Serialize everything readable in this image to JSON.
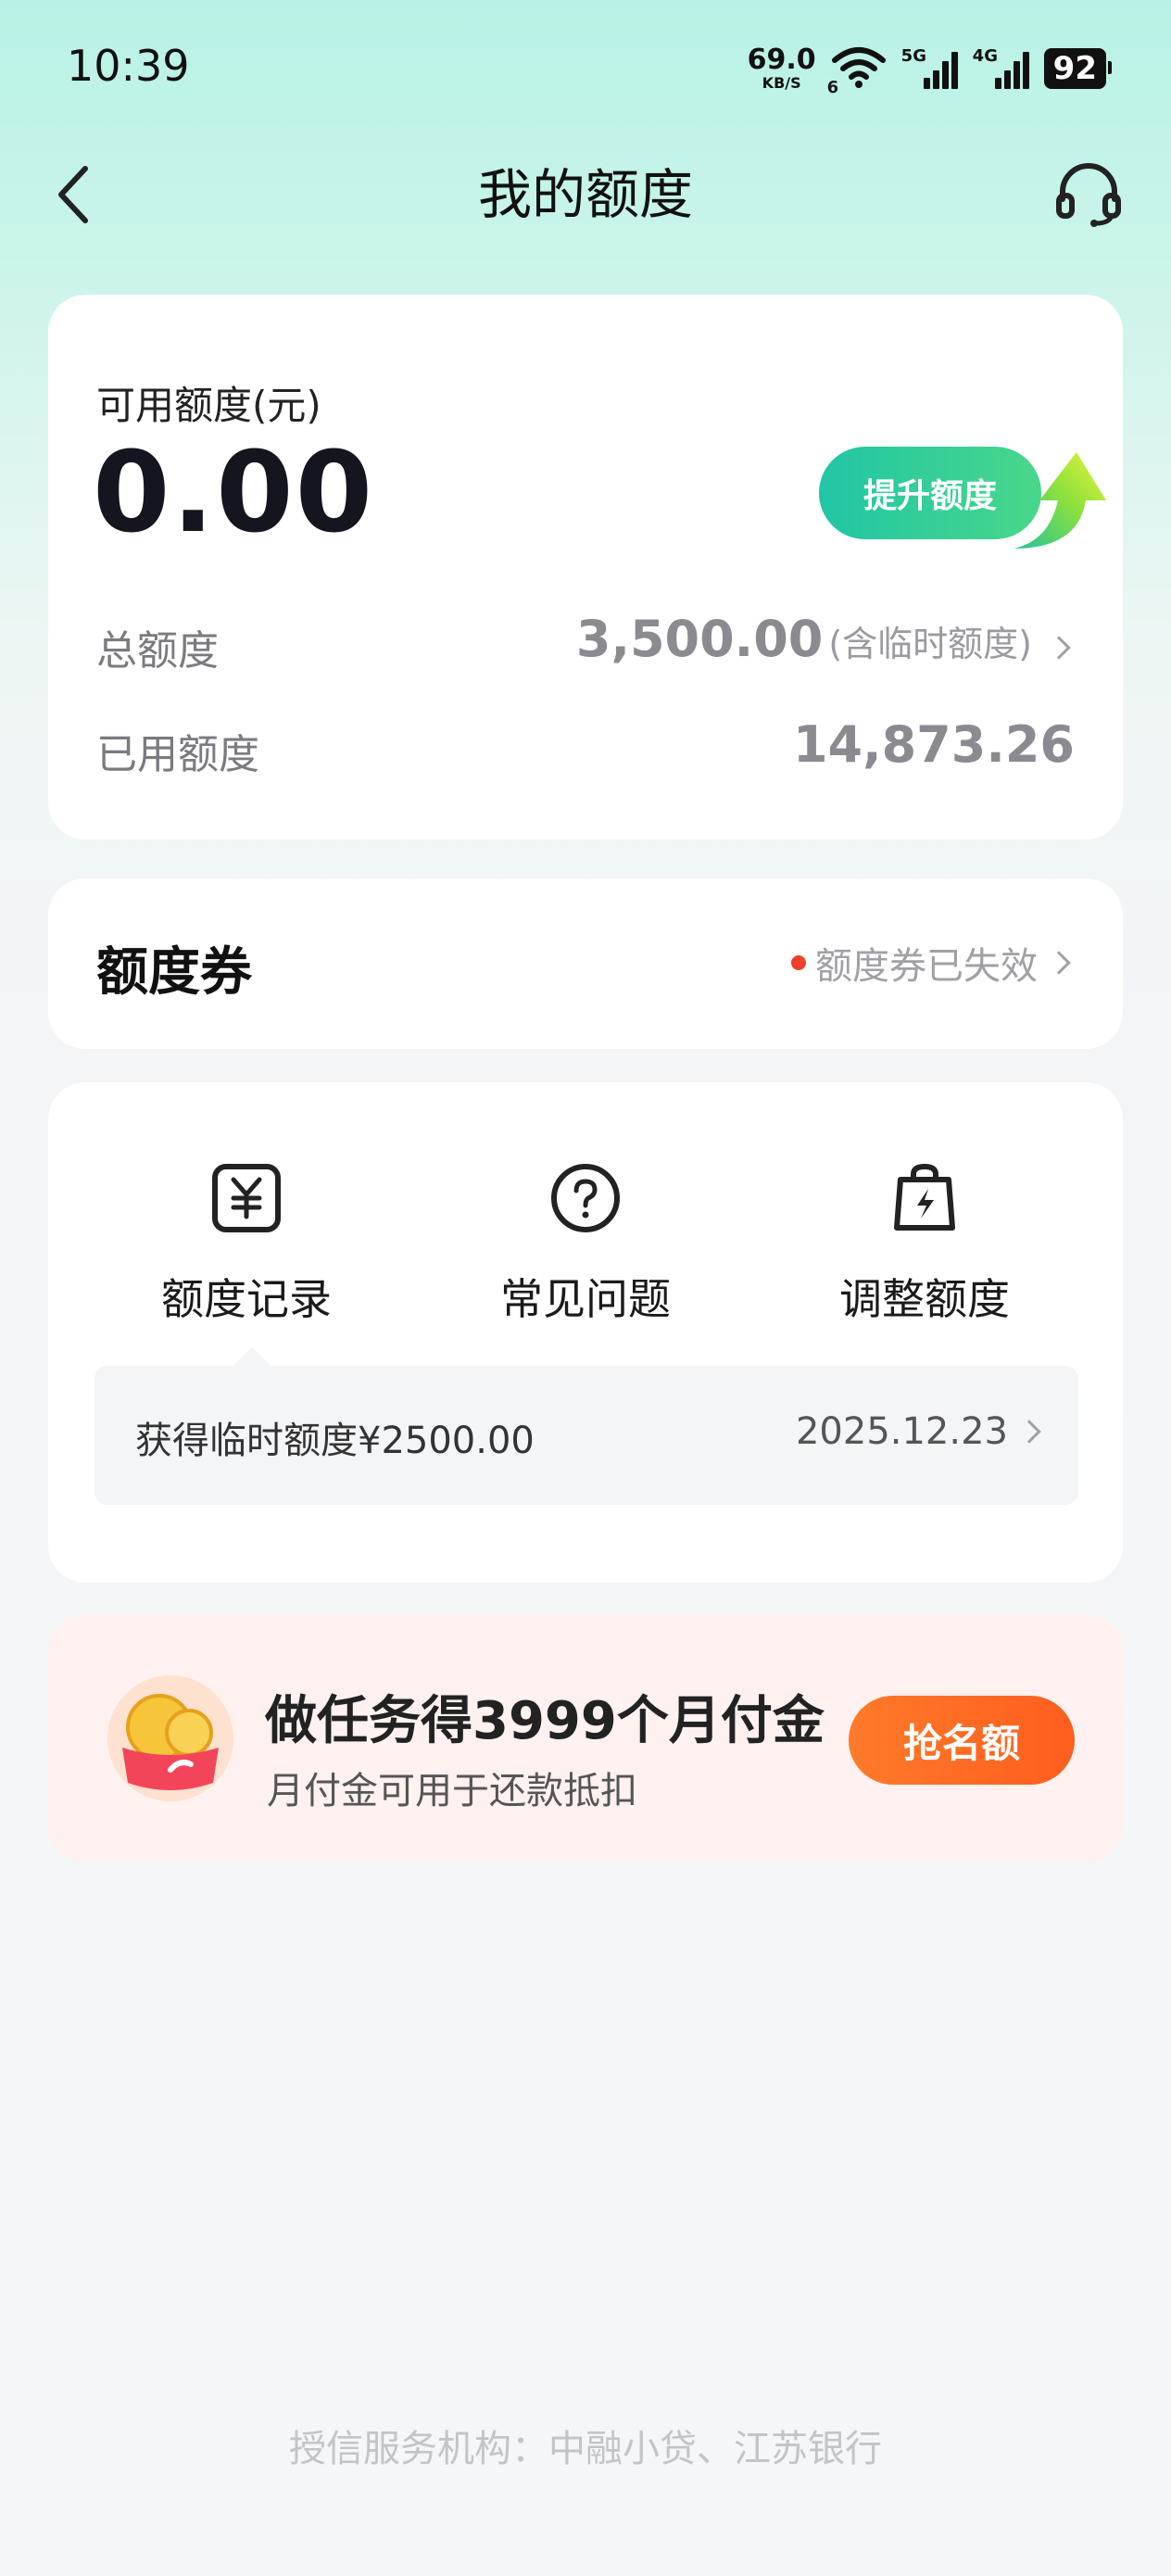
{
  "status_bar": {
    "time": "10:39",
    "net_speed": "69.0",
    "net_unit": "KB/S",
    "wifi_sub": "6",
    "signal1_label": "5G",
    "signal2_label": "4G",
    "battery": "92"
  },
  "nav": {
    "title": "我的额度",
    "back_icon": "chevron-left-icon",
    "service_icon": "headset-icon"
  },
  "credit": {
    "available_label": "可用额度(元)",
    "available_value": "0.00",
    "raise_button": "提升额度",
    "total_label": "总额度",
    "total_value": "3,500.00",
    "total_note": "(含临时额度)",
    "used_label": "已用额度",
    "used_value": "14,873.26"
  },
  "coupon": {
    "title": "额度券",
    "status": "额度券已失效"
  },
  "actions": {
    "items": [
      {
        "label": "额度记录",
        "icon": "yuan-receipt-icon"
      },
      {
        "label": "常见问题",
        "icon": "question-circle-icon"
      },
      {
        "label": "调整额度",
        "icon": "lightning-bag-icon"
      }
    ],
    "record_text": "获得临时额度¥2500.00",
    "record_date": "2025.12.23"
  },
  "promo": {
    "title": "做任务得3999个月付金",
    "subtitle": "月付金可用于还款抵扣",
    "button": "抢名额",
    "icon": "coin-wallet-icon"
  },
  "footer": "授信服务机构：中融小贷、江苏银行",
  "colors": {
    "accent_green": "#21c5a4",
    "promo_orange": "#ff6a22",
    "alert_red": "#f0402a"
  }
}
